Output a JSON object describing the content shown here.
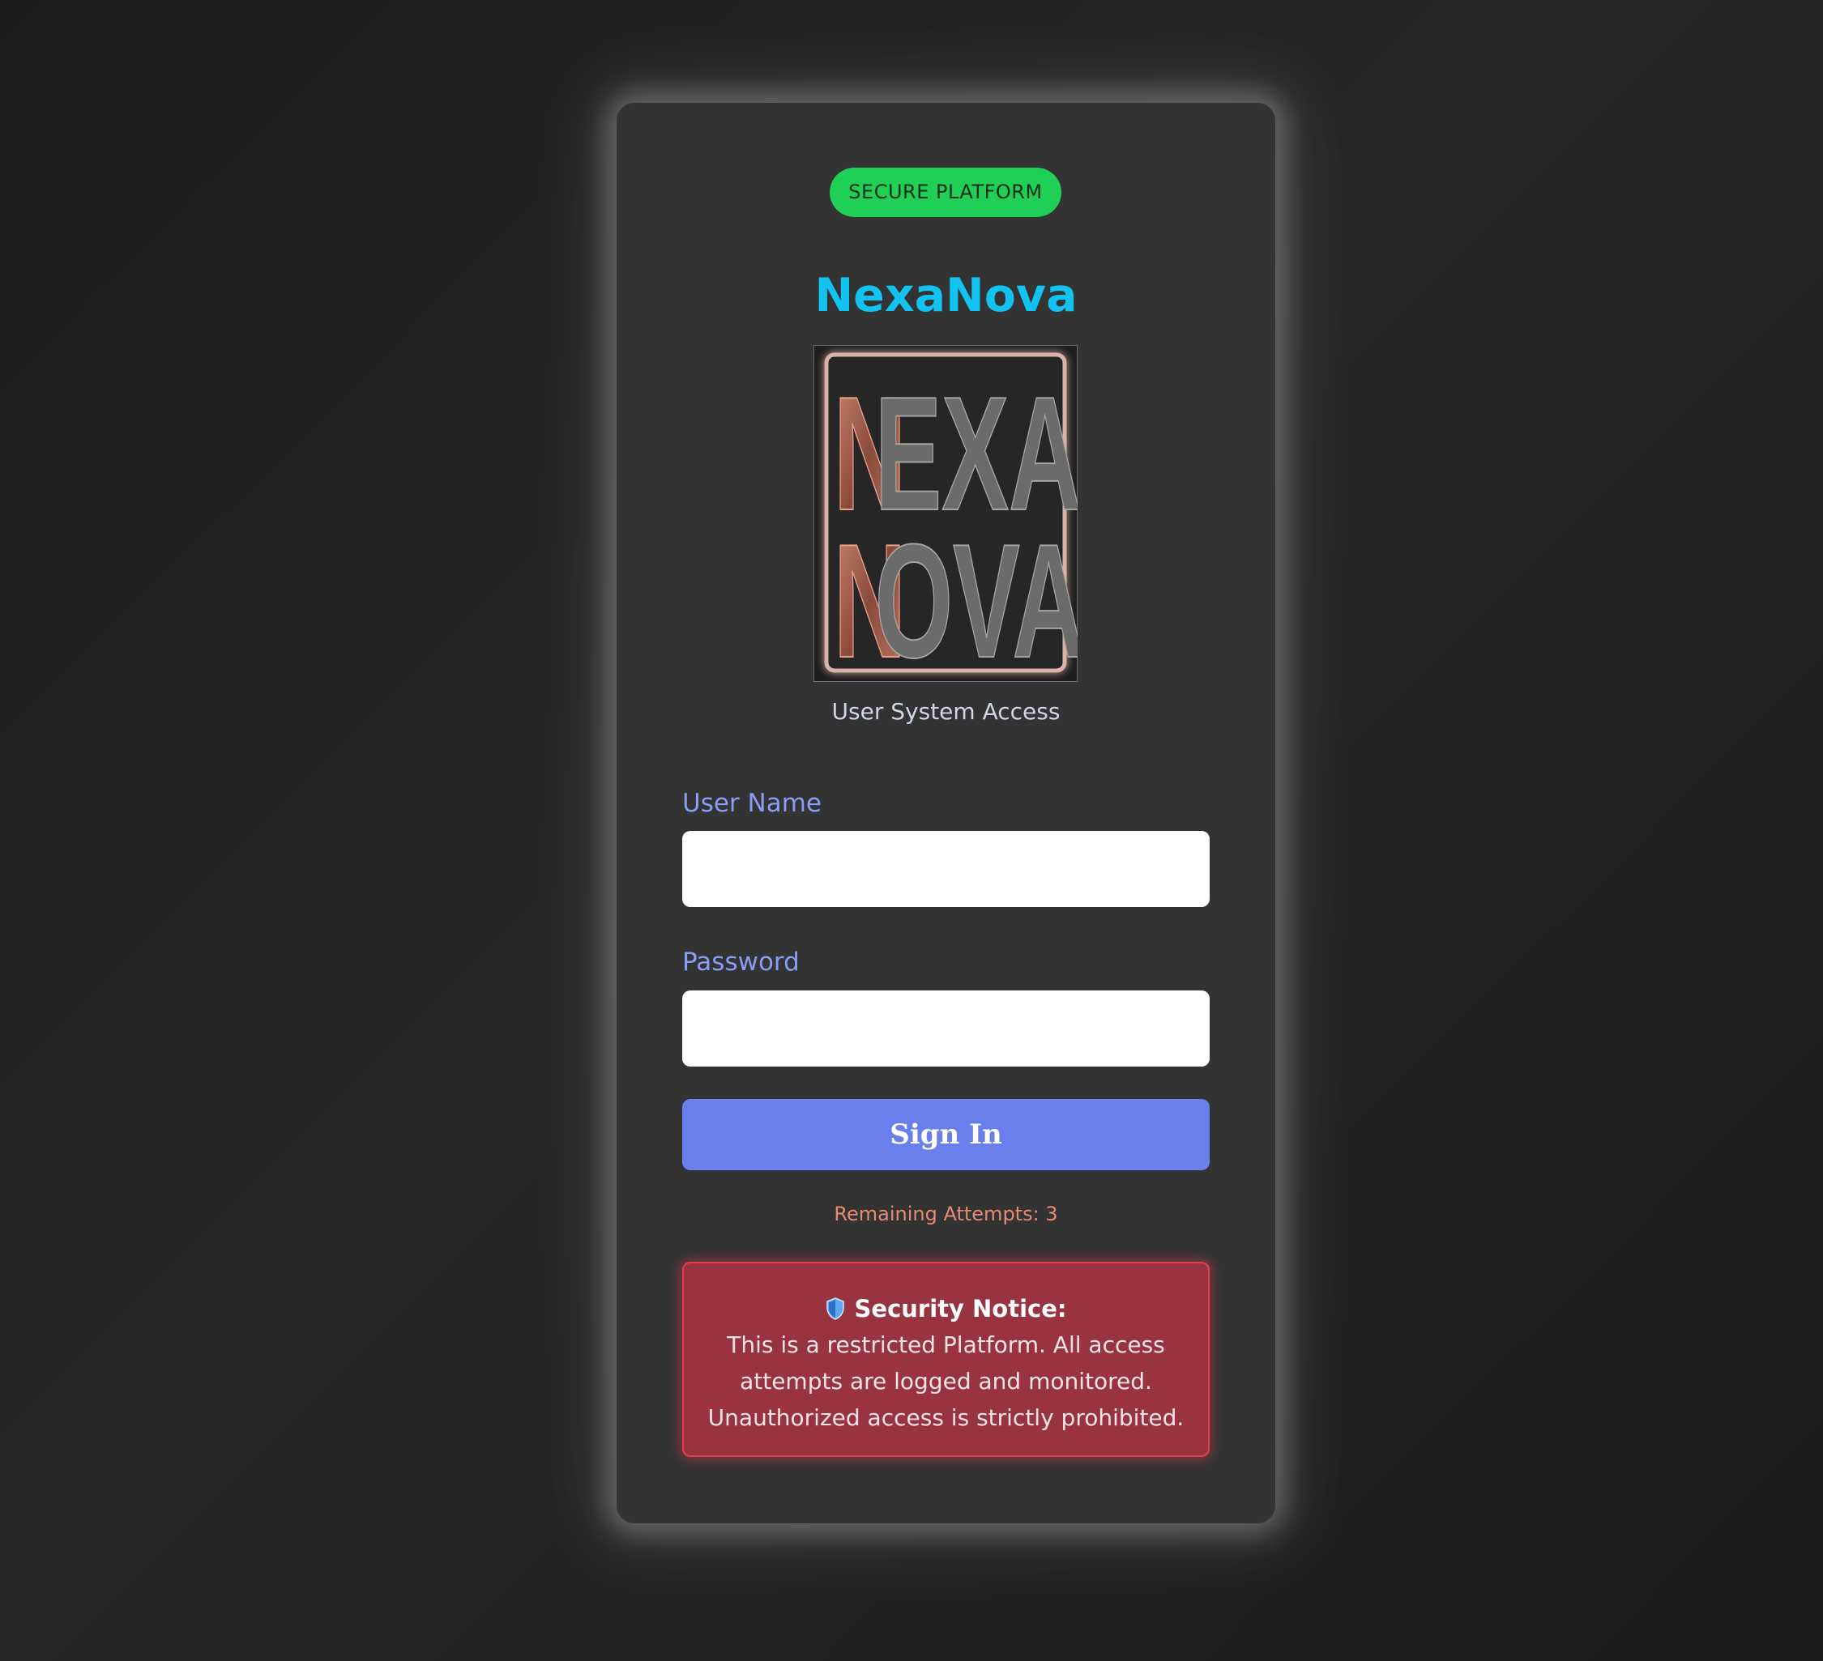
{
  "badge": {
    "label": "SECURE PLATFORM"
  },
  "brand": {
    "name": "NexaNova"
  },
  "logo": {
    "line1": "NEXA",
    "line2": "NOVA",
    "accent_color": "#b8705d",
    "letter_color": "#6b6b6b"
  },
  "tagline": "User System Access",
  "form": {
    "username_label": "User Name",
    "username_value": "",
    "password_label": "Password",
    "password_value": "",
    "signin_label": "Sign In"
  },
  "attempts": {
    "text": "Remaining Attempts: 3"
  },
  "notice": {
    "icon": "shield-icon",
    "title": "Security Notice:",
    "body": "This is a restricted Platform. All access attempts are logged and monitored. Unauthorized access is strictly prohibited."
  },
  "colors": {
    "badge_bg": "#1fcf56",
    "brand": "#12c2f0",
    "label": "#8b9cf5",
    "button": "#6a7fec",
    "attempts": "#e58a74",
    "notice_bg": "#993340",
    "notice_border": "#e04052"
  }
}
